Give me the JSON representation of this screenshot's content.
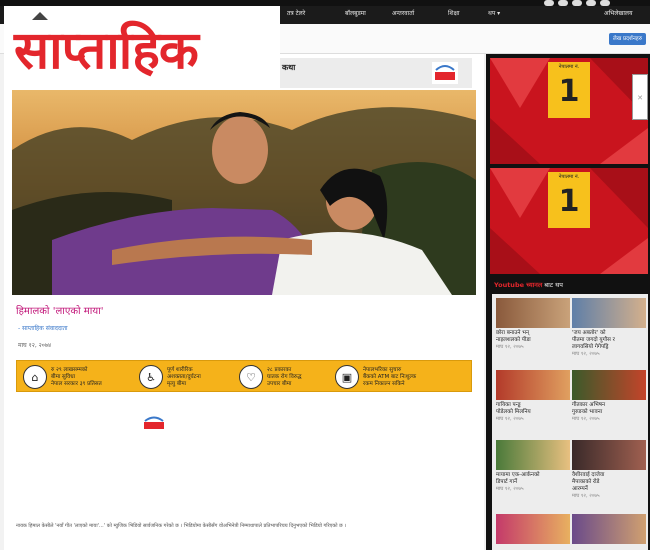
{
  "nav": {
    "items": [
      "तत्र टेलरे",
      "बॉलबुडमा",
      "अन्तरवार्ता",
      "शिक्षा",
      "थप ▾",
      "अभिलेखालय"
    ]
  },
  "subheader": {
    "search_label": "लेख प्रदर्शनहरु"
  },
  "logo": {
    "text": "साप्ताहिक"
  },
  "article": {
    "title_strip": "कथा",
    "headline": "हिमालको 'लाएको माया'",
    "author": "- साप्ताहिक संवाददाता",
    "date": "माघ १२, २०७४",
    "body": "नायक हिमाल केसीले 'नयाँ गीत 'लाएको माया'...' को म्युजिक भिडियो सार्वजनिक गरेको छ । भिडियोमा केसीसँग वोअभिनेत्री निम्माथापाले प्रतिभापरिचय दिनुभएको भिडियो गरिएको छ ।"
  },
  "banner": {
    "segments": [
      {
        "icon": "home-icon",
        "glyph": "⌂",
        "text": "रु २९ लाखसम्मको\nबीमा सुविधा\nनेपाल सरकार ३९ प्रतिसत"
      },
      {
        "icon": "wheelchair-icon",
        "glyph": "♿",
        "text": "पूर्ण शारीरिक\nअशक्तता/दुर्घटना\nमृत्यु बीमा"
      },
      {
        "icon": "heart-icon",
        "glyph": "♡",
        "text": "२८ प्रकारका\nघातक रोग विरुद्ध\nउपचार बीमा"
      },
      {
        "icon": "atm-icon",
        "glyph": "▣",
        "text": "नेपालभरिका सुचारु\nबैंकको ATM बाट निःशुल्क\nरकम निकाल्न सकिने"
      }
    ]
  },
  "ads": [
    {
      "label": "नेपालमा नं.",
      "number": "1"
    },
    {
      "label": "नेपालमा नं.",
      "number": "1"
    }
  ],
  "sidebar": {
    "youtube_prefix": "Youtube च्यानल",
    "youtube_suffix": "बाट थप",
    "videos": [
      {
        "title": "छोरा बनाउने भन्\nनाइलशलको पीडा",
        "date": "माघ १२, २०७५",
        "c1": "#8a5a3c",
        "c2": "#c9a27a"
      },
      {
        "title": "'जय अबतोर' को\nपीतमा जगदो युगौस र\nलागवसियो गेगेपड्रि",
        "date": "माघ १२, २०७५",
        "c1": "#5f7fa8",
        "c2": "#d4b08c"
      },
      {
        "title": "गायिका पन्ड्ड\nपोडेलको मिलनिय",
        "date": "माघ १२, २०७५",
        "c1": "#b33a2a",
        "c2": "#e0a060"
      },
      {
        "title": "गीतकार अभिषन\nगुरुङको भावना",
        "date": "माघ १२, २०७५",
        "c1": "#3a5a2a",
        "c2": "#c4442a"
      },
      {
        "title": "मायामा एक-आर्कनको\nडिपार्ट गार्ने",
        "date": "माघ १२, २०७५",
        "c1": "#4a7a3a",
        "c2": "#e8c080"
      },
      {
        "title": "वैशीरवाई दाजेवा\nमैपाकाको रोडे\nआरम्पर्ने",
        "date": "माघ १२, २०७५",
        "c1": "#3a2a2a",
        "c2": "#a06050"
      },
      {
        "title": "",
        "date": "",
        "c1": "#c43a6a",
        "c2": "#e8b060"
      },
      {
        "title": "",
        "date": "",
        "c1": "#6a4a8a",
        "c2": "#d0a070"
      }
    ]
  }
}
